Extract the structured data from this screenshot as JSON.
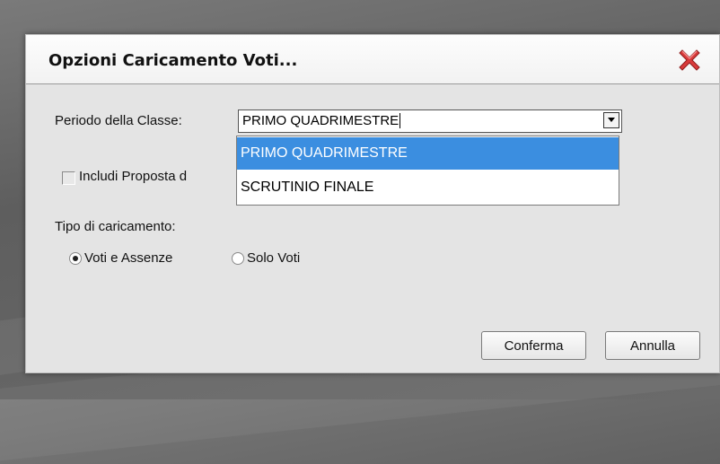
{
  "dialog": {
    "title": "Opzioni Caricamento Voti...",
    "close_icon": "close-x-icon"
  },
  "period": {
    "label": "Periodo della Classe:",
    "selected_value": "PRIMO QUADRIMESTRE",
    "options": [
      "PRIMO QUADRIMESTRE",
      "SCRUTINIO FINALE"
    ],
    "highlighted_index": 0
  },
  "include_proposal": {
    "label": "Includi Proposta d",
    "checked": false
  },
  "load_type": {
    "label": "Tipo di caricamento:",
    "options": [
      {
        "label": "Voti e Assenze",
        "selected": true
      },
      {
        "label": "Solo Voti",
        "selected": false
      }
    ]
  },
  "buttons": {
    "confirm": "Conferma",
    "cancel": "Annulla"
  },
  "colors": {
    "highlight": "#3b8ee0",
    "close_icon": "#d93a3a"
  }
}
